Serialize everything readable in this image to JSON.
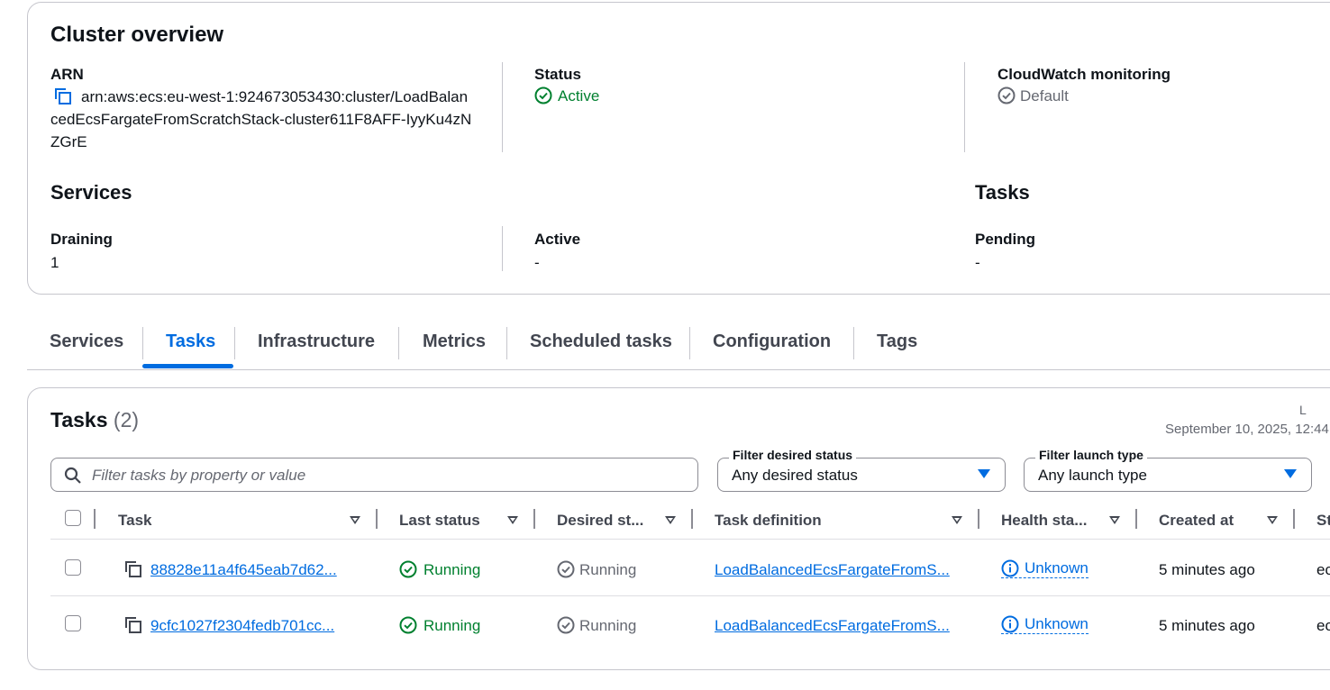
{
  "overview": {
    "title": "Cluster overview",
    "arn_label": "ARN",
    "arn_value": "arn:aws:ecs:eu-west-1:924673053430:cluster/LoadBalancedEcsFargateFromScratchStack-cluster611F8AFF-IyyKu4zNZGrE",
    "status_label": "Status",
    "status_value": "Active",
    "cloudwatch_label": "CloudWatch monitoring",
    "cloudwatch_value": "Default",
    "services_title": "Services",
    "tasks_title": "Tasks",
    "draining_label": "Draining",
    "draining_value": "1",
    "active_label": "Active",
    "active_value": "-",
    "pending_label": "Pending",
    "pending_value": "-"
  },
  "tabs": [
    "Services",
    "Tasks",
    "Infrastructure",
    "Metrics",
    "Scheduled tasks",
    "Configuration",
    "Tags"
  ],
  "tasks_panel": {
    "title": "Tasks",
    "count": "(2)",
    "last_updated_label": "L",
    "last_updated_value": "September 10, 2025, 12:44",
    "search_placeholder": "Filter tasks by property or value",
    "filter_desired_label": "Filter desired status",
    "filter_desired_value": "Any desired status",
    "filter_launch_label": "Filter launch type",
    "filter_launch_value": "Any launch type",
    "columns": [
      "Task",
      "Last status",
      "Desired st...",
      "Task definition",
      "Health sta...",
      "Created at",
      "St"
    ],
    "rows": [
      {
        "task": "88828e11a4f645eab7d62...",
        "last_status": "Running",
        "desired_status": "Running",
        "task_definition": "LoadBalancedEcsFargateFromS...",
        "health_status": "Unknown",
        "created_at": "5 minutes ago",
        "started_by": "ec"
      },
      {
        "task": "9cfc1027f2304fedb701cc...",
        "last_status": "Running",
        "desired_status": "Running",
        "task_definition": "LoadBalancedEcsFargateFromS...",
        "health_status": "Unknown",
        "created_at": "5 minutes ago",
        "started_by": "ec"
      }
    ]
  },
  "colors": {
    "link": "#006ce0",
    "success": "#00802f",
    "muted": "#656871",
    "border": "#c6c6cd"
  },
  "icons": [
    "copy-icon",
    "status-success-icon",
    "status-stopped-icon",
    "info-icon",
    "search-icon",
    "caret-down-icon",
    "sort-icon"
  ]
}
